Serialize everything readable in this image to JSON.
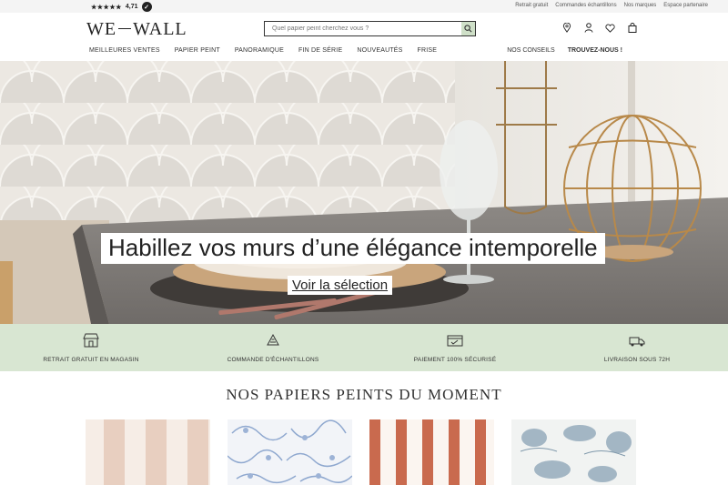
{
  "topbar": {
    "stars": "★★★★★",
    "rating": "4,71",
    "links": [
      "Retrait gratuit",
      "Commandes échantillons",
      "Nos marques",
      "Espace partenaire"
    ]
  },
  "header": {
    "logo_left": "WE",
    "logo_right": "WALL",
    "search_placeholder": "Quel papier peint cherchez vous ?"
  },
  "nav": {
    "left": [
      "MEILLEURES VENTES",
      "PAPIER PEINT",
      "PANORAMIQUE",
      "FIN DE SÉRIE",
      "NOUVEAUTÉS",
      "FRISE"
    ],
    "right": [
      "NOS CONSEILS",
      "TROUVEZ-NOUS !"
    ]
  },
  "hero": {
    "title": "Habillez vos murs d’une élégance intemporelle",
    "cta": "Voir la sélection"
  },
  "reassurance": [
    {
      "label": "RETRAIT GRATUIT EN MAGASIN",
      "icon": "store-icon"
    },
    {
      "label": "COMMANDE D'ÉCHANTILLONS",
      "icon": "swatch-icon"
    },
    {
      "label": "PAIEMENT 100% SÉCURISÉ",
      "icon": "secure-payment-icon"
    },
    {
      "label": "LIVRAISON SOUS 72H",
      "icon": "delivery-truck-icon"
    }
  ],
  "section": {
    "title": "NOS PAPIERS PEINTS DU MOMENT"
  },
  "colors": {
    "accent_green": "#d8e6d2",
    "search_button": "#cfe0c8",
    "stripe_beige": "#e8cfc0",
    "stripe_terracotta": "#c96a4e",
    "toile_blue": "#8fa8cf"
  }
}
